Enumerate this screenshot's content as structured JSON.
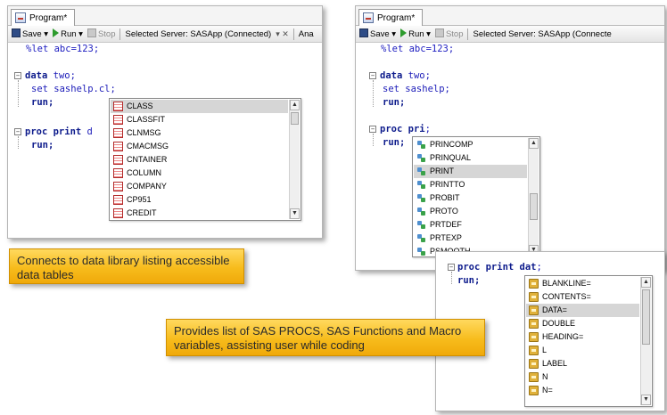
{
  "tab": {
    "label": "Program*"
  },
  "toolbar": {
    "save": "Save",
    "run": "Run",
    "stop": "Stop",
    "server_left": "Selected Server: SASApp (Connected)",
    "server_right": "Selected Server: SASApp (Connecte",
    "analyze": "Ana"
  },
  "editor1": {
    "lines": [
      "%let abc=123;",
      "data",
      " two;",
      "set",
      " sashelp.cl;",
      "run;",
      "proc print",
      " d",
      "run;"
    ]
  },
  "popup1": {
    "items": [
      "CLASS",
      "CLASSFIT",
      "CLNMSG",
      "CMACMSG",
      "CNTAINER",
      "COLUMN",
      "COMPANY",
      "CP951",
      "CREDIT"
    ],
    "selected": 0
  },
  "editor2": {
    "lines": [
      "%let abc=123;",
      "data",
      " two;",
      "set",
      " sashelp;",
      "run;",
      "proc",
      " pri",
      ";",
      "run;"
    ]
  },
  "popup2": {
    "items": [
      "PRINCOMP",
      "PRINQUAL",
      "PRINT",
      "PRINTTO",
      "PROBIT",
      "PROTO",
      "PRTDEF",
      "PRTEXP",
      "PSMOOTH"
    ],
    "selected": 2
  },
  "editor3": {
    "lines": [
      "proc print",
      " dat",
      ";",
      "run;"
    ]
  },
  "popup3": {
    "items": [
      "BLANKLINE=",
      "CONTENTS=",
      "DATA=",
      "DOUBLE",
      "HEADING=",
      "L",
      "LABEL",
      "N",
      "N="
    ],
    "selected": 2
  },
  "callouts": {
    "left": "Connects to data library listing accessible data tables",
    "bottom": "Provides list of SAS PROCS, SAS Functions and Macro variables, assisting user while coding"
  }
}
